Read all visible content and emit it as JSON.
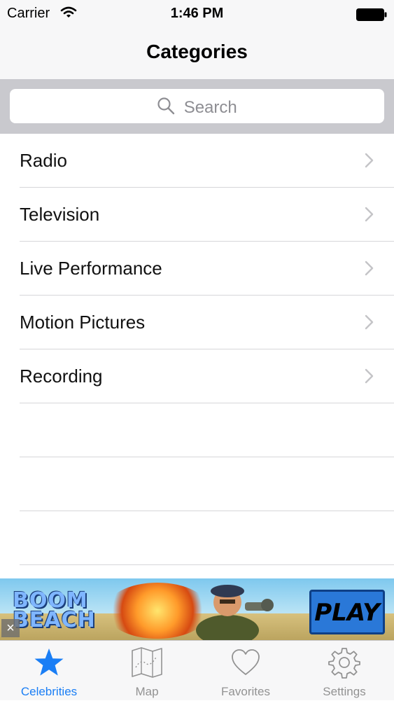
{
  "status": {
    "carrier": "Carrier",
    "time": "1:46 PM"
  },
  "nav": {
    "title": "Categories"
  },
  "search": {
    "placeholder": "Search",
    "icon": "search-icon"
  },
  "categories": [
    {
      "label": "Radio"
    },
    {
      "label": "Television"
    },
    {
      "label": "Live Performance"
    },
    {
      "label": "Motion Pictures"
    },
    {
      "label": "Recording"
    }
  ],
  "ad": {
    "logo_line1": "BOOM",
    "logo_line2": "BEACH",
    "play_label": "PLAY",
    "close_glyph": "×"
  },
  "tabs": [
    {
      "label": "Celebrities",
      "icon": "star-icon",
      "active": true
    },
    {
      "label": "Map",
      "icon": "map-icon",
      "active": false
    },
    {
      "label": "Favorites",
      "icon": "heart-icon",
      "active": false
    },
    {
      "label": "Settings",
      "icon": "gear-icon",
      "active": false
    }
  ],
  "colors": {
    "accent": "#1a7ef5",
    "inactive": "#929292",
    "separator": "#d6d6d9",
    "search_bg": "#c9c9ce"
  }
}
